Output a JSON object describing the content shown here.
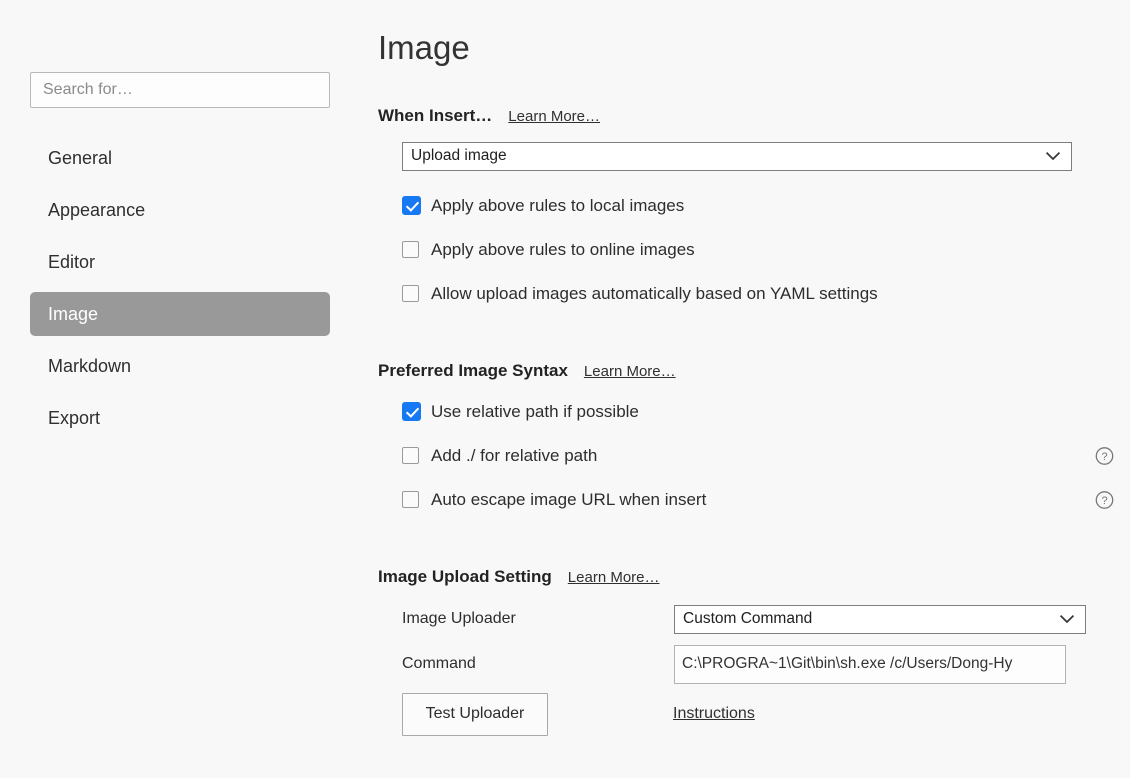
{
  "sidebar": {
    "search": {
      "placeholder": "Search for…",
      "value": ""
    },
    "items": [
      {
        "label": "General",
        "selected": false
      },
      {
        "label": "Appearance",
        "selected": false
      },
      {
        "label": "Editor",
        "selected": false
      },
      {
        "label": "Image",
        "selected": true
      },
      {
        "label": "Markdown",
        "selected": false
      },
      {
        "label": "Export",
        "selected": false
      }
    ]
  },
  "main": {
    "page_title": "Image",
    "sections": [
      {
        "title": "When Insert…",
        "learn_more": "Learn More…",
        "dropdown": {
          "value": "Upload image",
          "icon": "chevron-down-icon"
        },
        "checkboxes": [
          {
            "label": "Apply above rules to local images",
            "checked": true,
            "help": false
          },
          {
            "label": "Apply above rules to online images",
            "checked": false,
            "help": false
          },
          {
            "label": "Allow upload images automatically based on YAML settings",
            "checked": false,
            "help": false
          }
        ]
      },
      {
        "title": "Preferred Image Syntax",
        "learn_more": "Learn More…",
        "checkboxes": [
          {
            "label": "Use relative path if possible",
            "checked": true,
            "help": false
          },
          {
            "label": "Add ./ for relative path",
            "checked": false,
            "help": true
          },
          {
            "label": "Auto escape image URL when insert",
            "checked": false,
            "help": true
          }
        ]
      },
      {
        "title": "Image Upload Setting",
        "learn_more": "Learn More…",
        "uploader_label": "Image Uploader",
        "uploader_value": "Custom Command",
        "command_label": "Command",
        "command_value": "C:\\PROGRA~1\\Git\\bin\\sh.exe /c/Users/Dong-Hy",
        "test_button": "Test Uploader",
        "instructions_link": "Instructions"
      }
    ]
  },
  "icons": {
    "chevron_down": "chevron-down-icon",
    "help": "help-circle-icon"
  },
  "colors": {
    "accent_checkbox": "#1678f2",
    "selected_nav_bg": "#999999",
    "page_bg": "#f8f8f8",
    "field_border": "#7d7d7d"
  }
}
